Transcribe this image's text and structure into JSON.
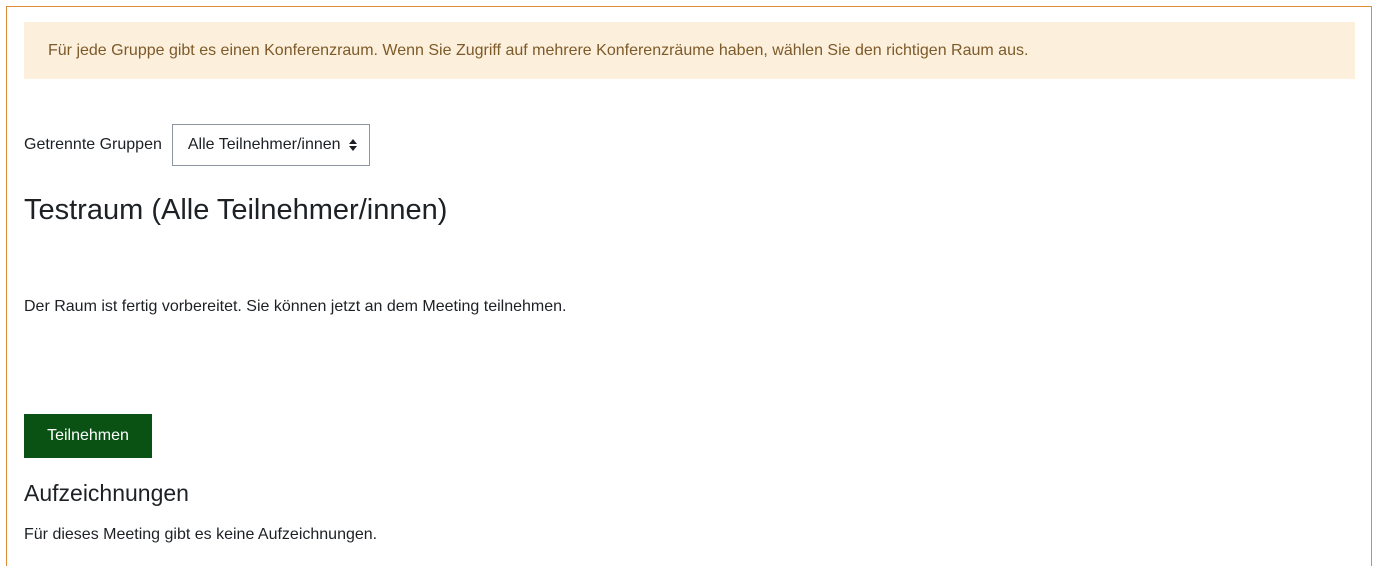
{
  "notice": {
    "text": "Für jede Gruppe gibt es einen Konferenzraum. Wenn Sie Zugriff auf mehrere Konferenzräume haben, wählen Sie den richtigen Raum aus."
  },
  "group_selector": {
    "label": "Getrennte Gruppen",
    "selected": "Alle Teilnehmer/innen"
  },
  "room": {
    "title": "Testraum (Alle Teilnehmer/innen)",
    "status": "Der Raum ist fertig vorbereitet. Sie können jetzt an dem Meeting teilnehmen.",
    "join_label": "Teilnehmen"
  },
  "recordings": {
    "title": "Aufzeichnungen",
    "empty_text": "Für dieses Meeting gibt es keine Aufzeichnungen."
  },
  "colors": {
    "frame_border": "#e08a3c",
    "notice_bg": "#fcefdc",
    "notice_text": "#7d5a29",
    "join_button_bg": "#0a5213"
  }
}
